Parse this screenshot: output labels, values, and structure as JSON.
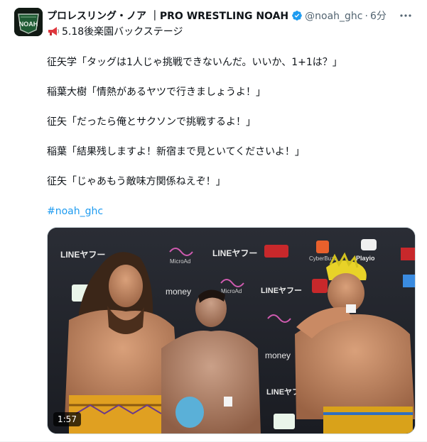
{
  "account": {
    "display_name": "プロレスリング・ノア ｜PRO WRESTLING NOAH",
    "handle": "@noah_ghc",
    "separator": "·",
    "time": "6分",
    "avatar_text": "NOAH"
  },
  "tweet": {
    "headline": "5.18後楽園バックステージ",
    "paragraphs": [
      "征矢学「タッグは1人じゃ挑戦できないんだ。いいか、1+1は？」",
      "稲葉大樹「情熱があるヤツで行きましょうよ！」",
      "征矢「だったら俺とサクソンで挑戦するよ！」",
      "稲葉「結果残しますよ！新宿まで見といてくださいよ！」",
      "征矢「じゃあもう敵味方関係ねえぞ！」"
    ],
    "hashtag": "#noah_ghc"
  },
  "media": {
    "duration": "1:57",
    "backdrop_logos": [
      "LINEヤフー",
      "MicroAd",
      "money",
      "CyberBuzz",
      "Playio"
    ]
  },
  "colors": {
    "link": "#1d9bf0",
    "muted": "#536471",
    "text": "#0f1419",
    "verified": "#1d9bf0"
  },
  "icons": {
    "verified": "verified-badge-icon",
    "more": "more-options-icon",
    "megaphone": "megaphone-icon"
  }
}
